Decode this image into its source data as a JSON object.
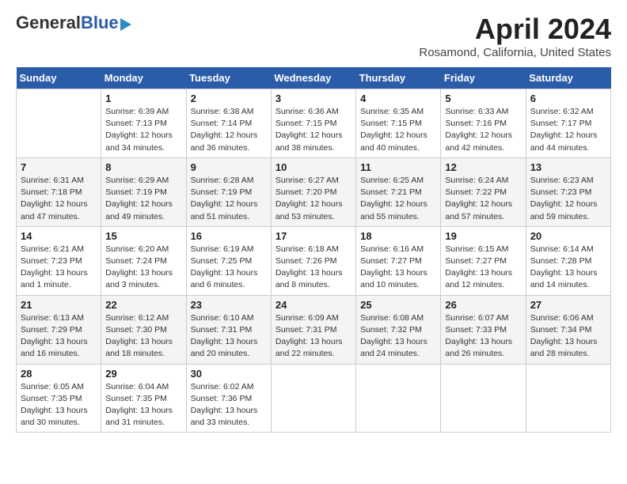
{
  "header": {
    "logo_general": "General",
    "logo_blue": "Blue",
    "month_title": "April 2024",
    "location": "Rosamond, California, United States"
  },
  "weekdays": [
    "Sunday",
    "Monday",
    "Tuesday",
    "Wednesday",
    "Thursday",
    "Friday",
    "Saturday"
  ],
  "weeks": [
    [
      {
        "date": "",
        "info": ""
      },
      {
        "date": "1",
        "info": "Sunrise: 6:39 AM\nSunset: 7:13 PM\nDaylight: 12 hours\nand 34 minutes."
      },
      {
        "date": "2",
        "info": "Sunrise: 6:38 AM\nSunset: 7:14 PM\nDaylight: 12 hours\nand 36 minutes."
      },
      {
        "date": "3",
        "info": "Sunrise: 6:36 AM\nSunset: 7:15 PM\nDaylight: 12 hours\nand 38 minutes."
      },
      {
        "date": "4",
        "info": "Sunrise: 6:35 AM\nSunset: 7:15 PM\nDaylight: 12 hours\nand 40 minutes."
      },
      {
        "date": "5",
        "info": "Sunrise: 6:33 AM\nSunset: 7:16 PM\nDaylight: 12 hours\nand 42 minutes."
      },
      {
        "date": "6",
        "info": "Sunrise: 6:32 AM\nSunset: 7:17 PM\nDaylight: 12 hours\nand 44 minutes."
      }
    ],
    [
      {
        "date": "7",
        "info": "Sunrise: 6:31 AM\nSunset: 7:18 PM\nDaylight: 12 hours\nand 47 minutes."
      },
      {
        "date": "8",
        "info": "Sunrise: 6:29 AM\nSunset: 7:19 PM\nDaylight: 12 hours\nand 49 minutes."
      },
      {
        "date": "9",
        "info": "Sunrise: 6:28 AM\nSunset: 7:19 PM\nDaylight: 12 hours\nand 51 minutes."
      },
      {
        "date": "10",
        "info": "Sunrise: 6:27 AM\nSunset: 7:20 PM\nDaylight: 12 hours\nand 53 minutes."
      },
      {
        "date": "11",
        "info": "Sunrise: 6:25 AM\nSunset: 7:21 PM\nDaylight: 12 hours\nand 55 minutes."
      },
      {
        "date": "12",
        "info": "Sunrise: 6:24 AM\nSunset: 7:22 PM\nDaylight: 12 hours\nand 57 minutes."
      },
      {
        "date": "13",
        "info": "Sunrise: 6:23 AM\nSunset: 7:23 PM\nDaylight: 12 hours\nand 59 minutes."
      }
    ],
    [
      {
        "date": "14",
        "info": "Sunrise: 6:21 AM\nSunset: 7:23 PM\nDaylight: 13 hours\nand 1 minute."
      },
      {
        "date": "15",
        "info": "Sunrise: 6:20 AM\nSunset: 7:24 PM\nDaylight: 13 hours\nand 3 minutes."
      },
      {
        "date": "16",
        "info": "Sunrise: 6:19 AM\nSunset: 7:25 PM\nDaylight: 13 hours\nand 6 minutes."
      },
      {
        "date": "17",
        "info": "Sunrise: 6:18 AM\nSunset: 7:26 PM\nDaylight: 13 hours\nand 8 minutes."
      },
      {
        "date": "18",
        "info": "Sunrise: 6:16 AM\nSunset: 7:27 PM\nDaylight: 13 hours\nand 10 minutes."
      },
      {
        "date": "19",
        "info": "Sunrise: 6:15 AM\nSunset: 7:27 PM\nDaylight: 13 hours\nand 12 minutes."
      },
      {
        "date": "20",
        "info": "Sunrise: 6:14 AM\nSunset: 7:28 PM\nDaylight: 13 hours\nand 14 minutes."
      }
    ],
    [
      {
        "date": "21",
        "info": "Sunrise: 6:13 AM\nSunset: 7:29 PM\nDaylight: 13 hours\nand 16 minutes."
      },
      {
        "date": "22",
        "info": "Sunrise: 6:12 AM\nSunset: 7:30 PM\nDaylight: 13 hours\nand 18 minutes."
      },
      {
        "date": "23",
        "info": "Sunrise: 6:10 AM\nSunset: 7:31 PM\nDaylight: 13 hours\nand 20 minutes."
      },
      {
        "date": "24",
        "info": "Sunrise: 6:09 AM\nSunset: 7:31 PM\nDaylight: 13 hours\nand 22 minutes."
      },
      {
        "date": "25",
        "info": "Sunrise: 6:08 AM\nSunset: 7:32 PM\nDaylight: 13 hours\nand 24 minutes."
      },
      {
        "date": "26",
        "info": "Sunrise: 6:07 AM\nSunset: 7:33 PM\nDaylight: 13 hours\nand 26 minutes."
      },
      {
        "date": "27",
        "info": "Sunrise: 6:06 AM\nSunset: 7:34 PM\nDaylight: 13 hours\nand 28 minutes."
      }
    ],
    [
      {
        "date": "28",
        "info": "Sunrise: 6:05 AM\nSunset: 7:35 PM\nDaylight: 13 hours\nand 30 minutes."
      },
      {
        "date": "29",
        "info": "Sunrise: 6:04 AM\nSunset: 7:35 PM\nDaylight: 13 hours\nand 31 minutes."
      },
      {
        "date": "30",
        "info": "Sunrise: 6:02 AM\nSunset: 7:36 PM\nDaylight: 13 hours\nand 33 minutes."
      },
      {
        "date": "",
        "info": ""
      },
      {
        "date": "",
        "info": ""
      },
      {
        "date": "",
        "info": ""
      },
      {
        "date": "",
        "info": ""
      }
    ]
  ]
}
